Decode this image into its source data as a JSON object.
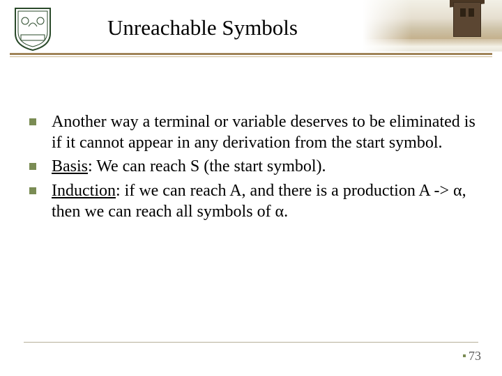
{
  "slide": {
    "title": "Unreachable Symbols",
    "pageNumber": "73"
  },
  "bullets": [
    {
      "prefix": "",
      "underlined": "",
      "rest": "Another way a terminal or variable deserves to be eliminated is if it cannot appear in any derivation from the start symbol."
    },
    {
      "prefix": "",
      "underlined": "Basis",
      "rest": ": We can reach S (the start symbol)."
    },
    {
      "prefix": "",
      "underlined": "Induction",
      "rest": ": if we can reach A, and there is a production A -> α, then we can reach all symbols of α."
    }
  ]
}
